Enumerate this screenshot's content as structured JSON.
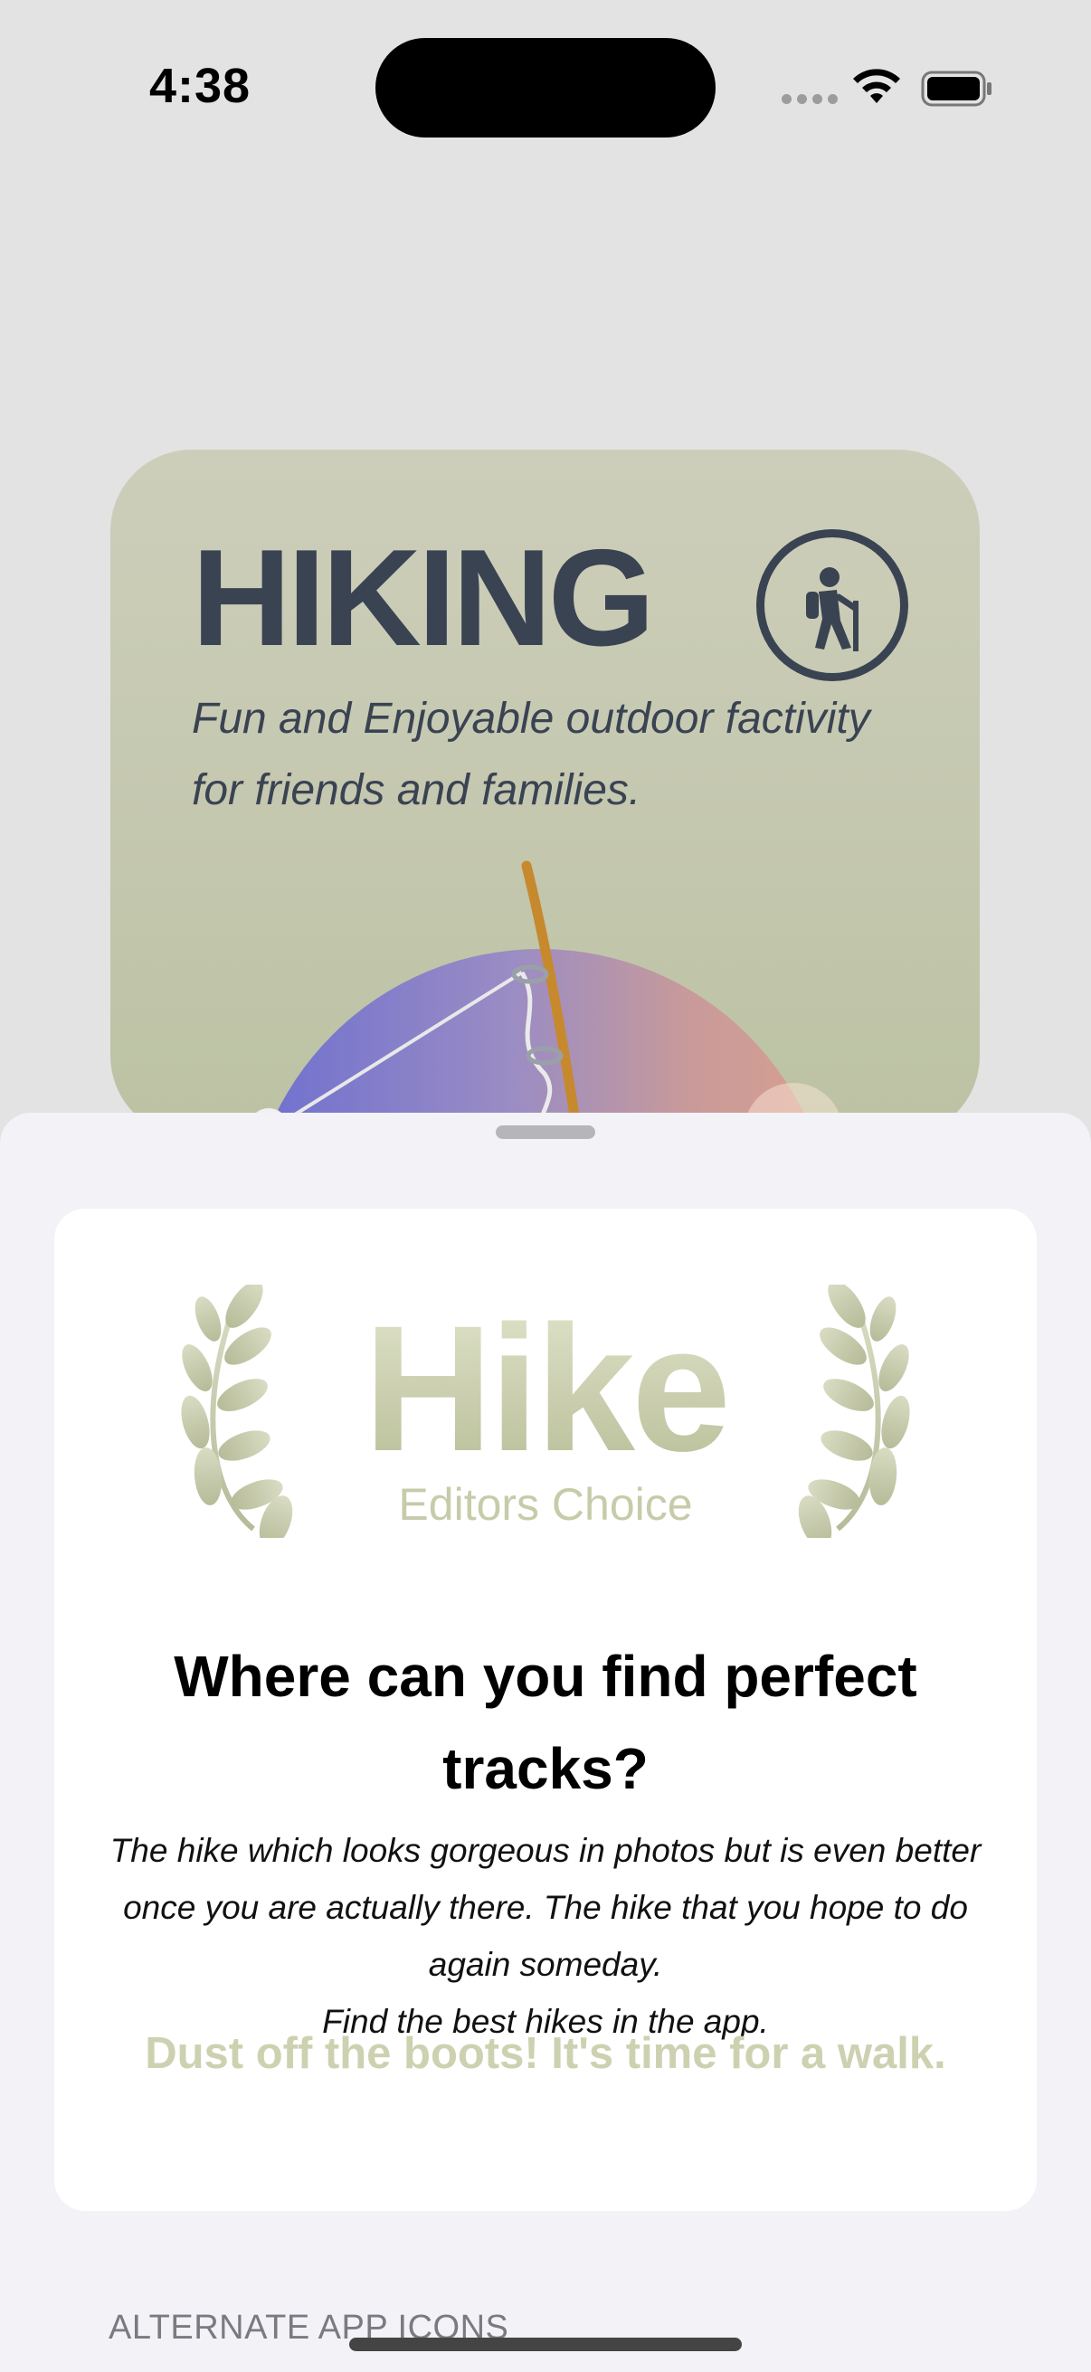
{
  "status_bar": {
    "time": "4:38"
  },
  "hero": {
    "title": "HIKING",
    "badge_icon": "hiker-icon",
    "subtitle": "Fun and Enjoyable outdoor factivity for friends and families."
  },
  "sheet": {
    "logo_title": "Hike",
    "logo_subtitle": "Editors Choice",
    "question": "Where can you find perfect tracks?",
    "body": "The hike which looks gorgeous in photos but is even better once you are actually there. The hike that you hope to do again someday.",
    "body_line2": "Find the best hikes in the app.",
    "cta": "Dust off the boots! It's time for a walk.",
    "section_header": "ALTERNATE APP ICONS"
  },
  "colors": {
    "hero_card": "#c6c9b1",
    "hero_text": "#3a4352",
    "logo_accent": "#c8ccad",
    "sheet_bg": "#f2f2f7"
  }
}
